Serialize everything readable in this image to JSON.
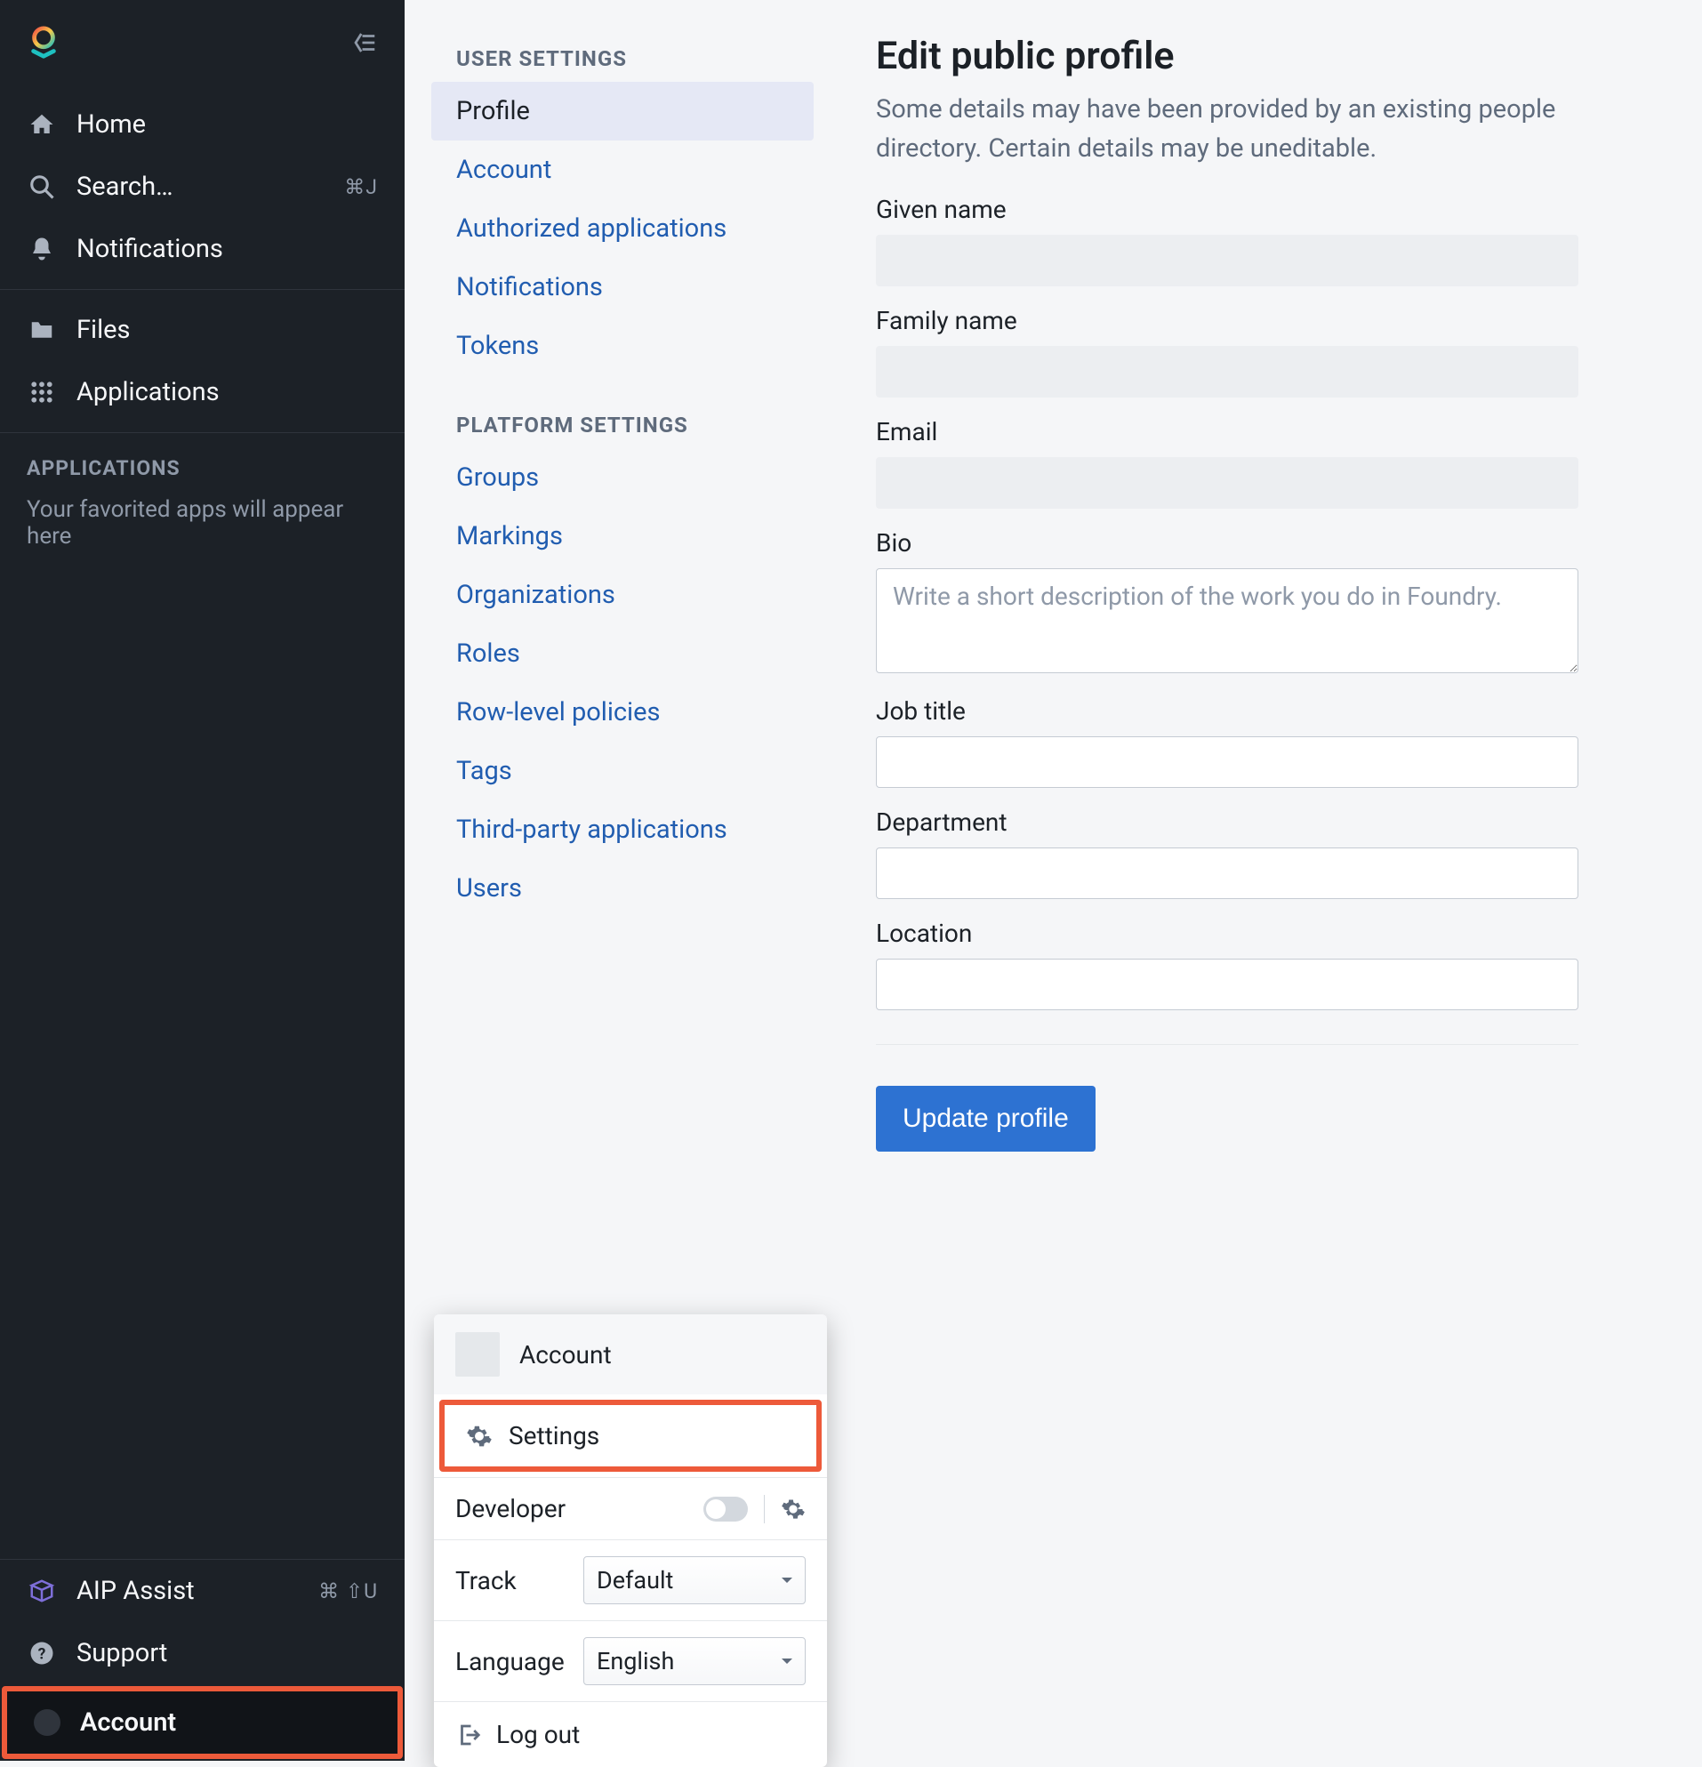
{
  "sidebar": {
    "nav": {
      "home": "Home",
      "search": "Search…",
      "search_kbd": "⌘J",
      "notifications": "Notifications",
      "files": "Files",
      "applications": "Applications"
    },
    "apps_header": "APPLICATIONS",
    "apps_empty": "Your favorited apps will appear here",
    "bottom": {
      "aip": "AIP Assist",
      "aip_kbd": "⌘ ⇧U",
      "support": "Support",
      "account": "Account"
    }
  },
  "popover": {
    "title": "Account",
    "settings": "Settings",
    "developer": "Developer",
    "track_label": "Track",
    "track_value": "Default",
    "language_label": "Language",
    "language_value": "English",
    "logout": "Log out"
  },
  "subnav": {
    "user_header": "USER SETTINGS",
    "user_items": {
      "profile": "Profile",
      "account": "Account",
      "authorized_applications": "Authorized applications",
      "notifications": "Notifications",
      "tokens": "Tokens"
    },
    "platform_header": "PLATFORM SETTINGS",
    "platform_items": {
      "groups": "Groups",
      "markings": "Markings",
      "organizations": "Organizations",
      "roles": "Roles",
      "row_level_policies": "Row-level policies",
      "tags": "Tags",
      "third_party_applications": "Third-party applications",
      "users": "Users"
    }
  },
  "main": {
    "title": "Edit public profile",
    "subtitle": "Some details may have been provided by an existing people directory. Certain details may be uneditable.",
    "labels": {
      "given_name": "Given name",
      "family_name": "Family name",
      "email": "Email",
      "bio": "Bio",
      "bio_placeholder": "Write a short description of the work you do in Foundry.",
      "job_title": "Job title",
      "department": "Department",
      "location": "Location"
    },
    "button": "Update profile"
  }
}
